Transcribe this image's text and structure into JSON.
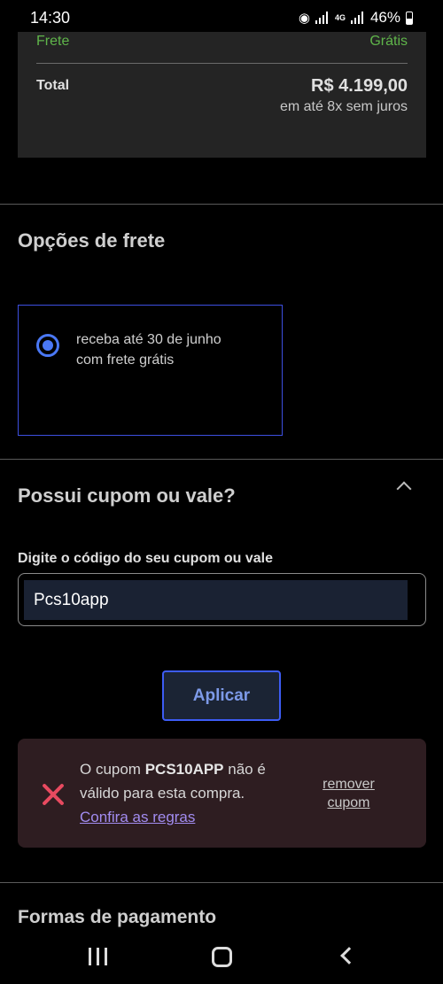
{
  "status_bar": {
    "time": "14:30",
    "network": "4G",
    "battery": "46%",
    "icons": [
      "hotspot-icon",
      "signal-icon",
      "network-4g-icon",
      "signal-icon",
      "battery-icon"
    ]
  },
  "summary": {
    "shipping_label": "Frete",
    "shipping_value": "Grátis",
    "total_label": "Total",
    "total_value": "R$ 4.199,00",
    "installments": "em até 8x sem juros"
  },
  "shipping_options": {
    "title": "Opções de frete",
    "option_line1": "receba até 30 de junho",
    "option_line2": "com frete grátis",
    "selected": true
  },
  "coupon": {
    "title": "Possui cupom ou vale?",
    "field_label": "Digite o código do seu cupom ou vale",
    "value": "Pcs10app",
    "apply_label": "Aplicar"
  },
  "error": {
    "prefix": "O cupom ",
    "code": "PCS10APP",
    "suffix": " não é válido para esta compra.",
    "rules_link": "Confira as regras",
    "remove_line1": "remover",
    "remove_line2": "cupom"
  },
  "payment": {
    "title": "Formas de pagamento"
  },
  "colors": {
    "accent": "#3d5cf5",
    "success": "#5fb54a",
    "error": "#e84a60",
    "link": "#a28cf0"
  }
}
